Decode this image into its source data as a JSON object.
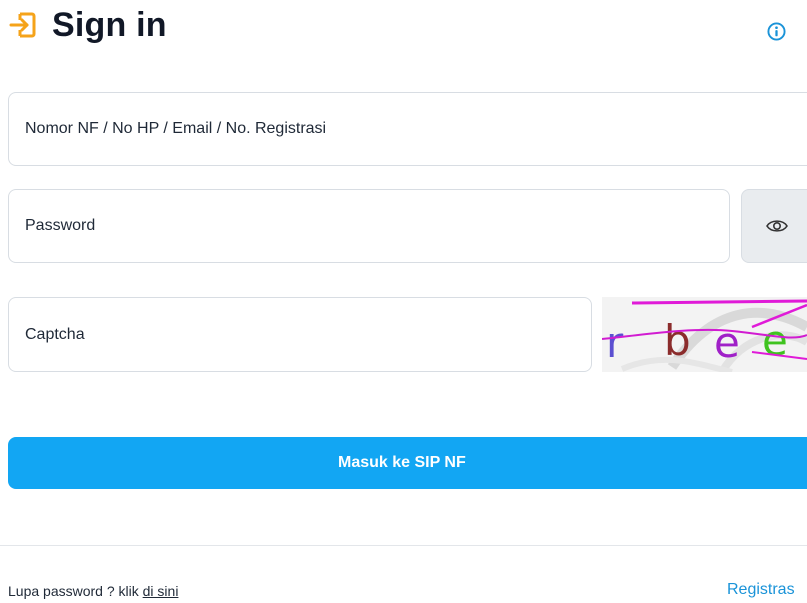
{
  "header": {
    "title": "Sign in",
    "signin_icon": "sign-in-icon",
    "info_icon": "info-icon",
    "accent_color": "#f5a31a",
    "info_color": "#1a93d8"
  },
  "form": {
    "username_placeholder": "Nomor NF / No HP / Email / No. Registrasi",
    "password_placeholder": "Password",
    "captcha_placeholder": "Captcha",
    "toggle_icon": "eye-icon",
    "captcha_text": "rbee",
    "submit_label": "Masuk ke SIP NF",
    "submit_color": "#12a6f3"
  },
  "footer": {
    "forgot_text": "Lupa password ? klik",
    "forgot_link": "di sini",
    "register_link": "Registras"
  }
}
